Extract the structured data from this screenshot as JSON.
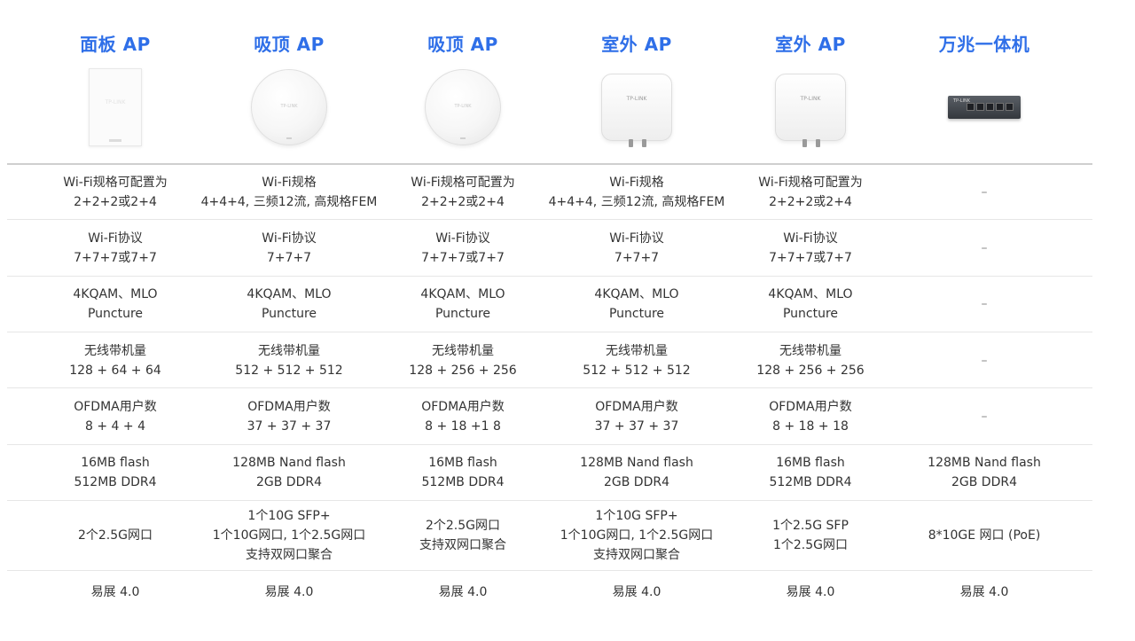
{
  "products": [
    {
      "title": "面板 AP",
      "image": "panel-ap",
      "brand": "TP-LINK",
      "specs": [
        "Wi-Fi规格可配置为\n2+2+2或2+4",
        "Wi-Fi协议\n7+7+7或7+7",
        "4KQAM、MLO\nPuncture",
        "无线带机量\n128 + 64 + 64",
        "OFDMA用户数\n8 + 4 + 4",
        "16MB flash\n512MB DDR4",
        "2个2.5G网口",
        "易展 4.0"
      ]
    },
    {
      "title": "吸顶 AP",
      "image": "ceiling-ap",
      "brand": "TP-LINK",
      "specs": [
        "Wi-Fi规格\n4+4+4, 三频12流, 高规格FEM",
        "Wi-Fi协议\n7+7+7",
        "4KQAM、MLO\nPuncture",
        "无线带机量\n512 + 512 + 512",
        "OFDMA用户数\n37 + 37 + 37",
        "128MB Nand flash\n2GB DDR4",
        "1个10G SFP+\n1个10G网口, 1个2.5G网口\n支持双网口聚合",
        "易展 4.0"
      ]
    },
    {
      "title": "吸顶 AP",
      "image": "ceiling-ap",
      "brand": "TP-LINK",
      "specs": [
        "Wi-Fi规格可配置为\n2+2+2或2+4",
        "Wi-Fi协议\n7+7+7或7+7",
        "4KQAM、MLO\nPuncture",
        "无线带机量\n128 + 256 + 256",
        "OFDMA用户数\n8 + 18 +1 8",
        "16MB flash\n512MB DDR4",
        "2个2.5G网口\n支持双网口聚合",
        "易展 4.0"
      ]
    },
    {
      "title": "室外 AP",
      "image": "outdoor-ap",
      "brand": "TP-LINK",
      "specs": [
        "Wi-Fi规格\n4+4+4, 三频12流, 高规格FEM",
        "Wi-Fi协议\n7+7+7",
        "4KQAM、MLO\nPuncture",
        "无线带机量\n512 + 512 + 512",
        "OFDMA用户数\n37 + 37 + 37",
        "128MB Nand flash\n2GB DDR4",
        "1个10G SFP+\n1个10G网口, 1个2.5G网口\n支持双网口聚合",
        "易展 4.0"
      ]
    },
    {
      "title": "室外 AP",
      "image": "outdoor-ap",
      "brand": "TP-LINK",
      "specs": [
        "Wi-Fi规格可配置为\n2+2+2或2+4",
        "Wi-Fi协议\n7+7+7或7+7",
        "4KQAM、MLO\nPuncture",
        "无线带机量\n128 + 256 + 256",
        "OFDMA用户数\n8 + 18 + 18",
        "16MB flash\n512MB DDR4",
        "1个2.5G SFP\n1个2.5G网口",
        "易展 4.0"
      ]
    },
    {
      "title": "万兆一体机",
      "image": "switch",
      "brand": "TP-LINK",
      "specs": [
        "–",
        "–",
        "–",
        "–",
        "–",
        "128MB Nand flash\n2GB DDR4",
        "8*10GE 网口 (PoE)",
        "易展 4.0"
      ]
    }
  ],
  "colors": {
    "title": "#2f6fe8",
    "text": "#333333",
    "divider": "#e6e6e6"
  }
}
